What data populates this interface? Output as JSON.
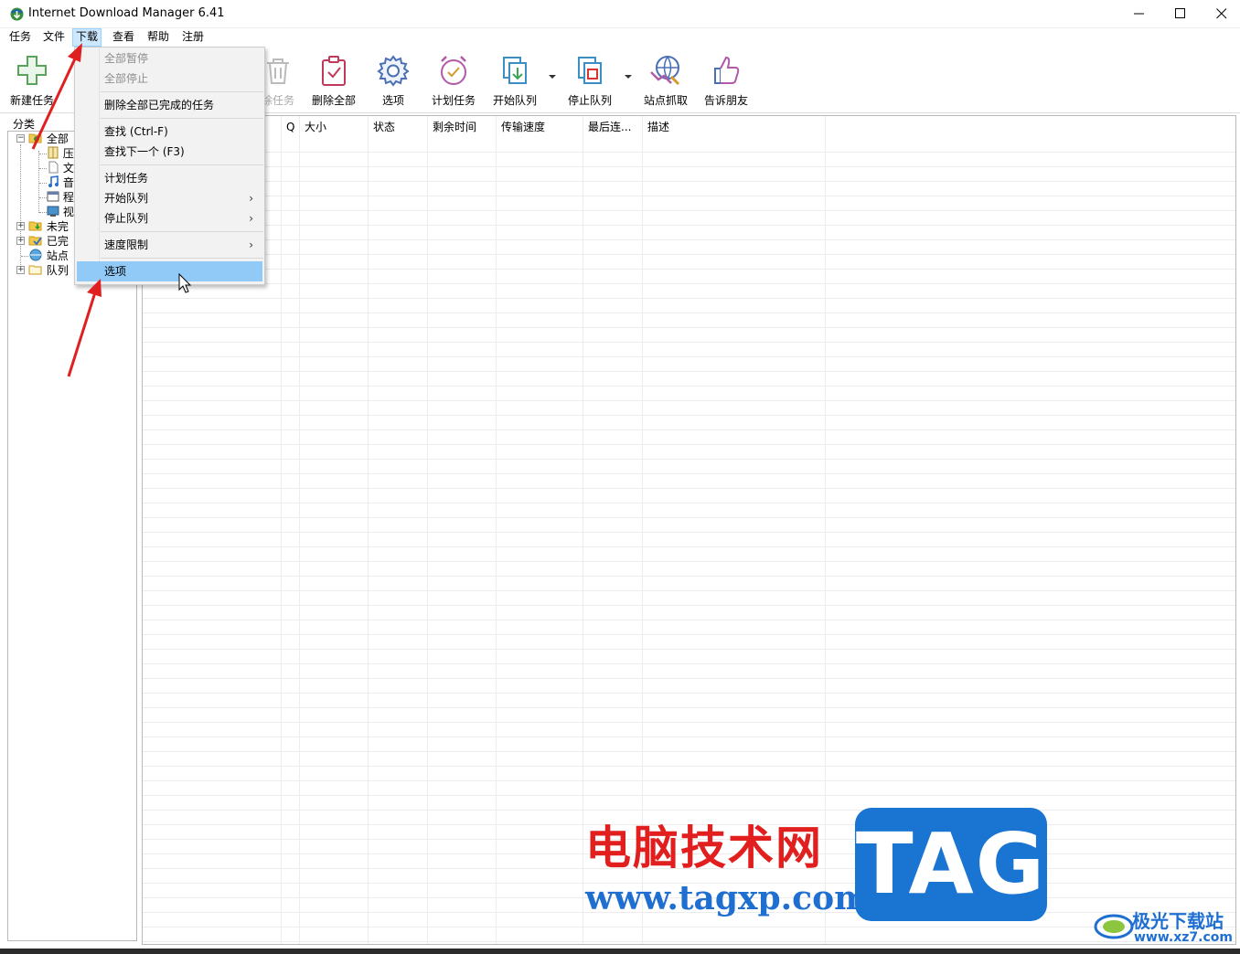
{
  "window": {
    "title": "Internet Download Manager 6.41"
  },
  "menubar": {
    "items": [
      "任务",
      "文件",
      "下载",
      "查看",
      "帮助",
      "注册"
    ],
    "active_index": 2
  },
  "toolbar": {
    "buttons": [
      {
        "label": "新建任务",
        "icon": "plus-icon",
        "enabled": true
      },
      {
        "label": "删除任务",
        "icon": "trash-icon",
        "enabled": false
      },
      {
        "label": "删除全部",
        "icon": "clipboard-delete-icon",
        "enabled": true
      },
      {
        "label": "选项",
        "icon": "gear-icon",
        "enabled": true
      },
      {
        "label": "计划任务",
        "icon": "alarm-clock-icon",
        "enabled": true
      },
      {
        "label": "开始队列",
        "icon": "start-queue-icon",
        "enabled": true
      },
      {
        "label": "停止队列",
        "icon": "stop-queue-icon",
        "enabled": true
      },
      {
        "label": "站点抓取",
        "icon": "site-grabber-icon",
        "enabled": true
      },
      {
        "label": "告诉朋友",
        "icon": "thumbs-up-icon",
        "enabled": true
      }
    ],
    "partial_label": "除任务"
  },
  "categories": {
    "title": "分类",
    "nodes": [
      {
        "label": "全部",
        "icon": "folder-open-icon"
      },
      {
        "label": "压",
        "icon": "archive-icon"
      },
      {
        "label": "文",
        "icon": "document-icon"
      },
      {
        "label": "音",
        "icon": "music-note-icon"
      },
      {
        "label": "程",
        "icon": "program-icon"
      },
      {
        "label": "视",
        "icon": "video-icon"
      },
      {
        "label": "未完",
        "icon": "folder-download-icon"
      },
      {
        "label": "已完",
        "icon": "folder-check-icon"
      },
      {
        "label": "站点",
        "icon": "site-icon"
      },
      {
        "label": "队列",
        "icon": "folder-icon"
      }
    ]
  },
  "list": {
    "columns": [
      "Q",
      "大小",
      "状态",
      "剩余时间",
      "传输速度",
      "最后连...",
      "描述"
    ]
  },
  "download_menu": {
    "items": [
      {
        "label": "全部暂停",
        "enabled": false
      },
      {
        "label": "全部停止",
        "enabled": false
      },
      {
        "label": "删除全部已完成的任务",
        "enabled": true
      },
      {
        "label": "查找 (Ctrl-F)",
        "enabled": true
      },
      {
        "label": "查找下一个 (F3)",
        "enabled": true
      },
      {
        "label": "计划任务",
        "enabled": true
      },
      {
        "label": "开始队列",
        "enabled": true,
        "submenu": true
      },
      {
        "label": "停止队列",
        "enabled": true,
        "submenu": true
      },
      {
        "label": "速度限制",
        "enabled": true,
        "submenu": true
      },
      {
        "label": "选项",
        "enabled": true,
        "highlighted": true
      }
    ],
    "submenu_glyph": "›"
  },
  "watermarks": {
    "site_name_cn": "电脑技术网",
    "site_url": "www.tagxp.com",
    "tag_logo": "TAG",
    "site2_name_cn": "极光下载站",
    "site2_url": "www.xz7.com"
  },
  "colors": {
    "menu_highlight": "#91c9f7",
    "menubar_active": "#cce8ff",
    "annotation_arrow": "#e02020",
    "watermark_red": "#e11f1f",
    "watermark_blue": "#1a75d2"
  }
}
